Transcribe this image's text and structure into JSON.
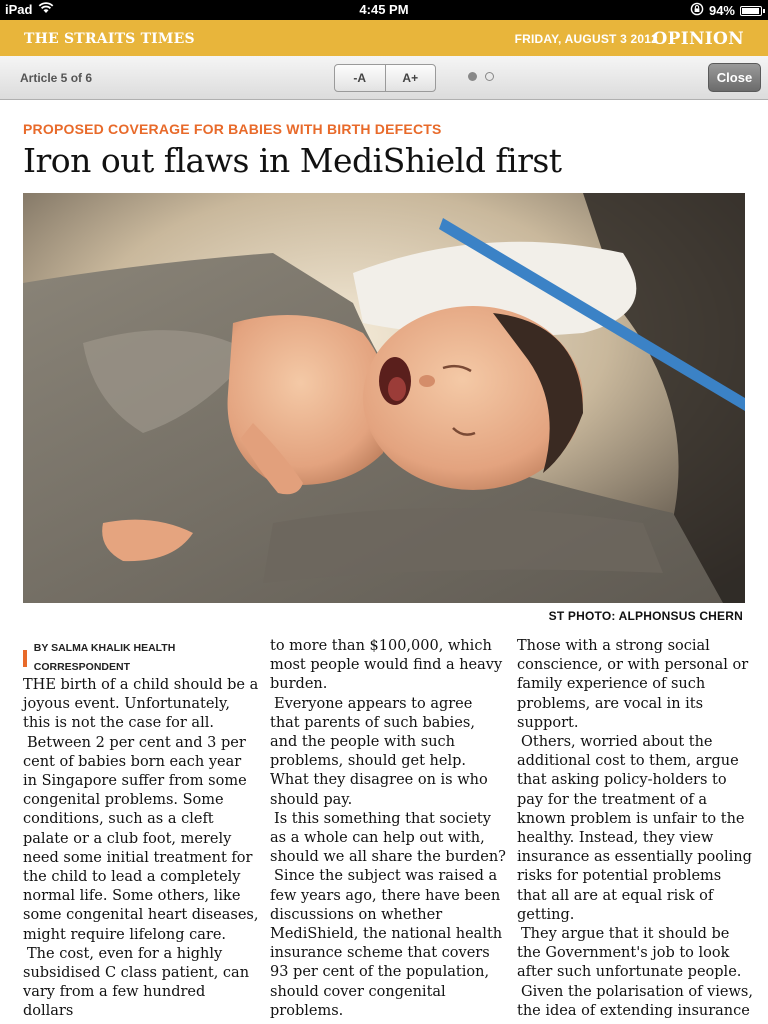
{
  "status_bar": {
    "device": "iPad",
    "time": "4:45 PM",
    "battery": "94%",
    "battery_level": 0.94
  },
  "masthead": {
    "paper_name": "THE STRAITS TIMES",
    "date": "FRIDAY, AUGUST 3 2012",
    "section": "OPINION"
  },
  "toolbar": {
    "article_count": "Article 5 of 6",
    "font_decrease": "-A",
    "font_increase": "A+",
    "page_dots": {
      "total": 2,
      "current": 1
    },
    "close_label": "Close"
  },
  "article": {
    "kicker": "PROPOSED COVERAGE FOR BABIES WITH BIRTH DEFECTS",
    "headline": "Iron out flaws in MediShield first",
    "photo_credit": "ST PHOTO: ALPHONSUS CHERN",
    "byline": "BY SALMA KHALIK HEALTH CORRESPONDENT",
    "col1": [
      "THE birth of a child should be a joyous event. Unfortunately, this is not the case for all.",
      "Between 2 per cent and 3 per cent of babies born each year in Singapore suffer from some congenital problems. Some conditions, such as a cleft palate or a club foot, merely need some initial treatment for the child to lead a completely normal life. Some others, like some congenital heart diseases, might require lifelong care.",
      "The cost, even for a highly subsidised C class patient, can vary from a few hundred dollars"
    ],
    "col2": [
      "to more than $100,000, which most people would find a heavy burden.",
      "Everyone appears to agree that parents of such babies, and the people with such problems, should get help. What they disagree on is who should pay.",
      "Is this something that society as a whole can help out with, should we all share the burden?",
      "Since the subject was raised a few years ago, there have been discussions on whether MediShield, the national health insurance scheme that covers 93 per cent of the population, should cover congenital problems."
    ],
    "col3": [
      "Those with a strong social conscience, or with personal or family experience of such problems, are vocal in its support.",
      "Others, worried about the additional cost to them, argue that asking policy-holders to pay for the treatment of a known problem is unfair to the healthy. Instead, they view insurance as essentially pooling risks for potential problems that all are at equal risk of getting.",
      "They argue that it should be the Government's job to look after such unfortunate people.",
      "Given the polarisation of views, the idea of extending insurance"
    ]
  },
  "icons": {
    "wifi": "wifi-icon",
    "lock": "rotation-lock-icon",
    "battery": "battery-icon"
  }
}
